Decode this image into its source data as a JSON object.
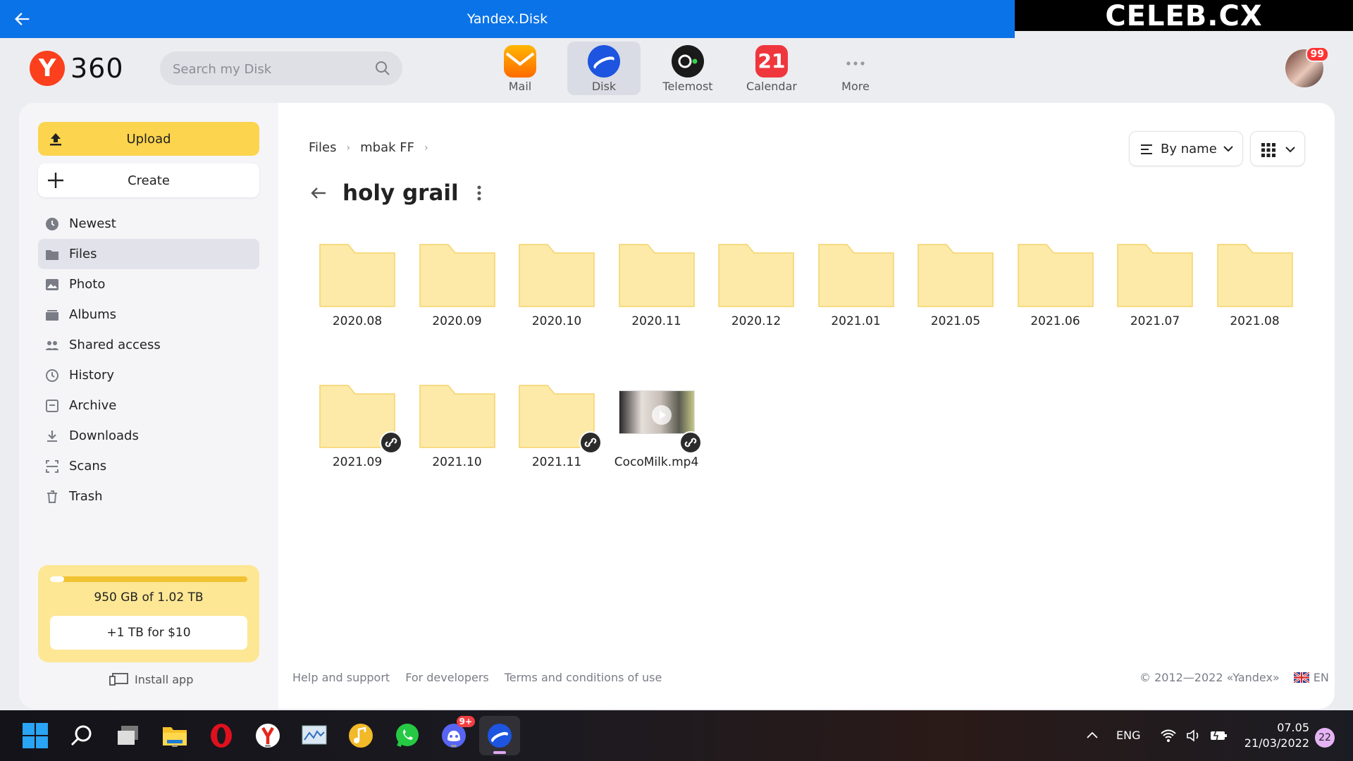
{
  "titlebar": {
    "title": "Yandex.Disk"
  },
  "watermark": {
    "text": "CELEB.CX"
  },
  "header": {
    "logo_text": "360",
    "search_placeholder": "Search my Disk",
    "apps": [
      {
        "label": "Mail",
        "icon": "mail-icon"
      },
      {
        "label": "Disk",
        "icon": "disk-icon",
        "active": true
      },
      {
        "label": "Telemost",
        "icon": "telemost-icon"
      },
      {
        "label": "Calendar",
        "icon": "calendar-icon",
        "day": "21"
      },
      {
        "label": "More",
        "icon": "more-dots-icon"
      }
    ],
    "avatar_badge": "99"
  },
  "sidebar": {
    "upload_label": "Upload",
    "create_label": "Create",
    "items": [
      {
        "label": "Newest",
        "icon": "clock-icon"
      },
      {
        "label": "Files",
        "icon": "files-icon",
        "active": true
      },
      {
        "label": "Photo",
        "icon": "photo-icon"
      },
      {
        "label": "Albums",
        "icon": "albums-icon"
      },
      {
        "label": "Shared access",
        "icon": "people-icon"
      },
      {
        "label": "History",
        "icon": "history-icon"
      },
      {
        "label": "Archive",
        "icon": "archive-icon"
      },
      {
        "label": "Downloads",
        "icon": "download-icon"
      },
      {
        "label": "Scans",
        "icon": "scan-icon"
      },
      {
        "label": "Trash",
        "icon": "trash-icon"
      }
    ],
    "storage": {
      "used_text": "950 GB of 1.02 TB",
      "free_fraction": 0.07,
      "buy_label": "+1 TB for $10"
    },
    "install_label": "Install app"
  },
  "content": {
    "breadcrumbs": [
      "Files",
      "mbak FF"
    ],
    "folder_title": "holy grail",
    "sort_label": "By name",
    "items": [
      {
        "name": "2020.08",
        "type": "folder",
        "shared": false
      },
      {
        "name": "2020.09",
        "type": "folder",
        "shared": false
      },
      {
        "name": "2020.10",
        "type": "folder",
        "shared": false
      },
      {
        "name": "2020.11",
        "type": "folder",
        "shared": false
      },
      {
        "name": "2020.12",
        "type": "folder",
        "shared": false
      },
      {
        "name": "2021.01",
        "type": "folder",
        "shared": false
      },
      {
        "name": "2021.05",
        "type": "folder",
        "shared": false
      },
      {
        "name": "2021.06",
        "type": "folder",
        "shared": false
      },
      {
        "name": "2021.07",
        "type": "folder",
        "shared": false
      },
      {
        "name": "2021.08",
        "type": "folder",
        "shared": false
      },
      {
        "name": "2021.09",
        "type": "folder",
        "shared": true
      },
      {
        "name": "2021.10",
        "type": "folder",
        "shared": false
      },
      {
        "name": "2021.11",
        "type": "folder",
        "shared": true
      },
      {
        "name": "CocoMilk.mp4",
        "type": "video",
        "shared": true
      }
    ]
  },
  "footer": {
    "links": [
      "Help and support",
      "For developers",
      "Terms and conditions of use"
    ],
    "copyright": "© 2012—2022 «Yandex»",
    "language": "EN"
  },
  "taskbar": {
    "discord_badge": "9+",
    "language": "ENG",
    "time": "07.05",
    "date": "21/03/2022",
    "notifications": "22"
  },
  "colors": {
    "titlebar": "#0b73e8",
    "upload": "#fcd44d",
    "folder": "#fdeaa8",
    "folder_border": "#f5d36a"
  }
}
